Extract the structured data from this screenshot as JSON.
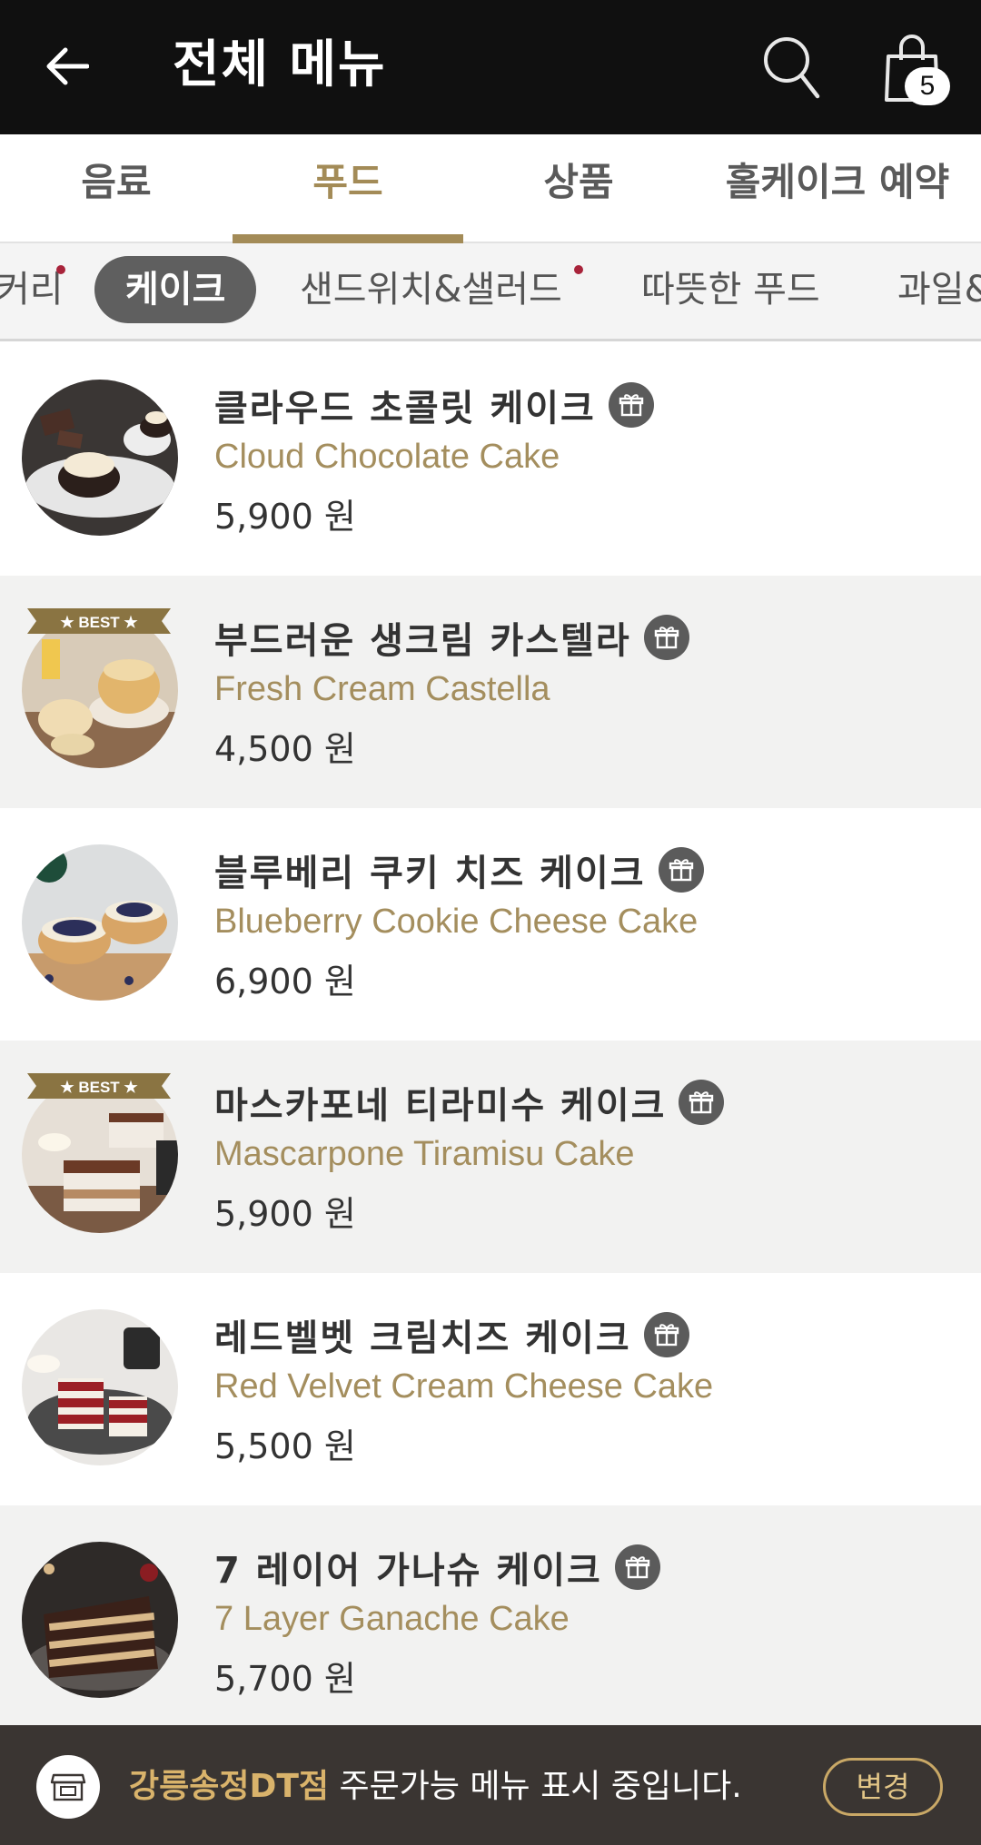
{
  "header": {
    "title": "전체 메뉴",
    "cart_count": "5"
  },
  "main_tabs": [
    {
      "label": "음료"
    },
    {
      "label": "푸드"
    },
    {
      "label": "상품"
    },
    {
      "label": "홀케이크 예약"
    }
  ],
  "sub_categories": [
    {
      "label": "브레드·베이커리",
      "visible_label": "커리"
    },
    {
      "label": "케이크"
    },
    {
      "label": "샌드위치&샐러드"
    },
    {
      "label": "따뜻한 푸드"
    },
    {
      "label": "과일&"
    }
  ],
  "products": [
    {
      "name_ko": "클라우드 초콜릿 케이크",
      "name_en": "Cloud Chocolate Cake",
      "price": "5,900 원",
      "best": false
    },
    {
      "name_ko": "부드러운 생크림 카스텔라",
      "name_en": "Fresh Cream Castella",
      "price": "4,500 원",
      "best": true
    },
    {
      "name_ko": "블루베리 쿠키 치즈 케이크",
      "name_en": "Blueberry Cookie Cheese Cake",
      "price": "6,900 원",
      "best": false
    },
    {
      "name_ko": "마스카포네 티라미수 케이크",
      "name_en": "Mascarpone Tiramisu Cake",
      "price": "5,900 원",
      "best": true
    },
    {
      "name_ko": "레드벨벳 크림치즈 케이크",
      "name_en": "Red Velvet Cream Cheese Cake",
      "price": "5,500 원",
      "best": false
    },
    {
      "name_ko": "7 레이어 가나슈 케이크",
      "name_en": "7 Layer Ganache Cake",
      "price": "5,700 원",
      "best": false
    }
  ],
  "badge": {
    "best_label": "★ BEST ★"
  },
  "store_bar": {
    "store_name": "강릉송정DT점",
    "message": " 주문가능 메뉴 표시 중입니다.",
    "change_label": "변경"
  },
  "colors": {
    "accent": "#a38b57",
    "header_bg": "#101010",
    "notice_dot": "#a8233a",
    "store_bar_bg": "#3a3532"
  }
}
